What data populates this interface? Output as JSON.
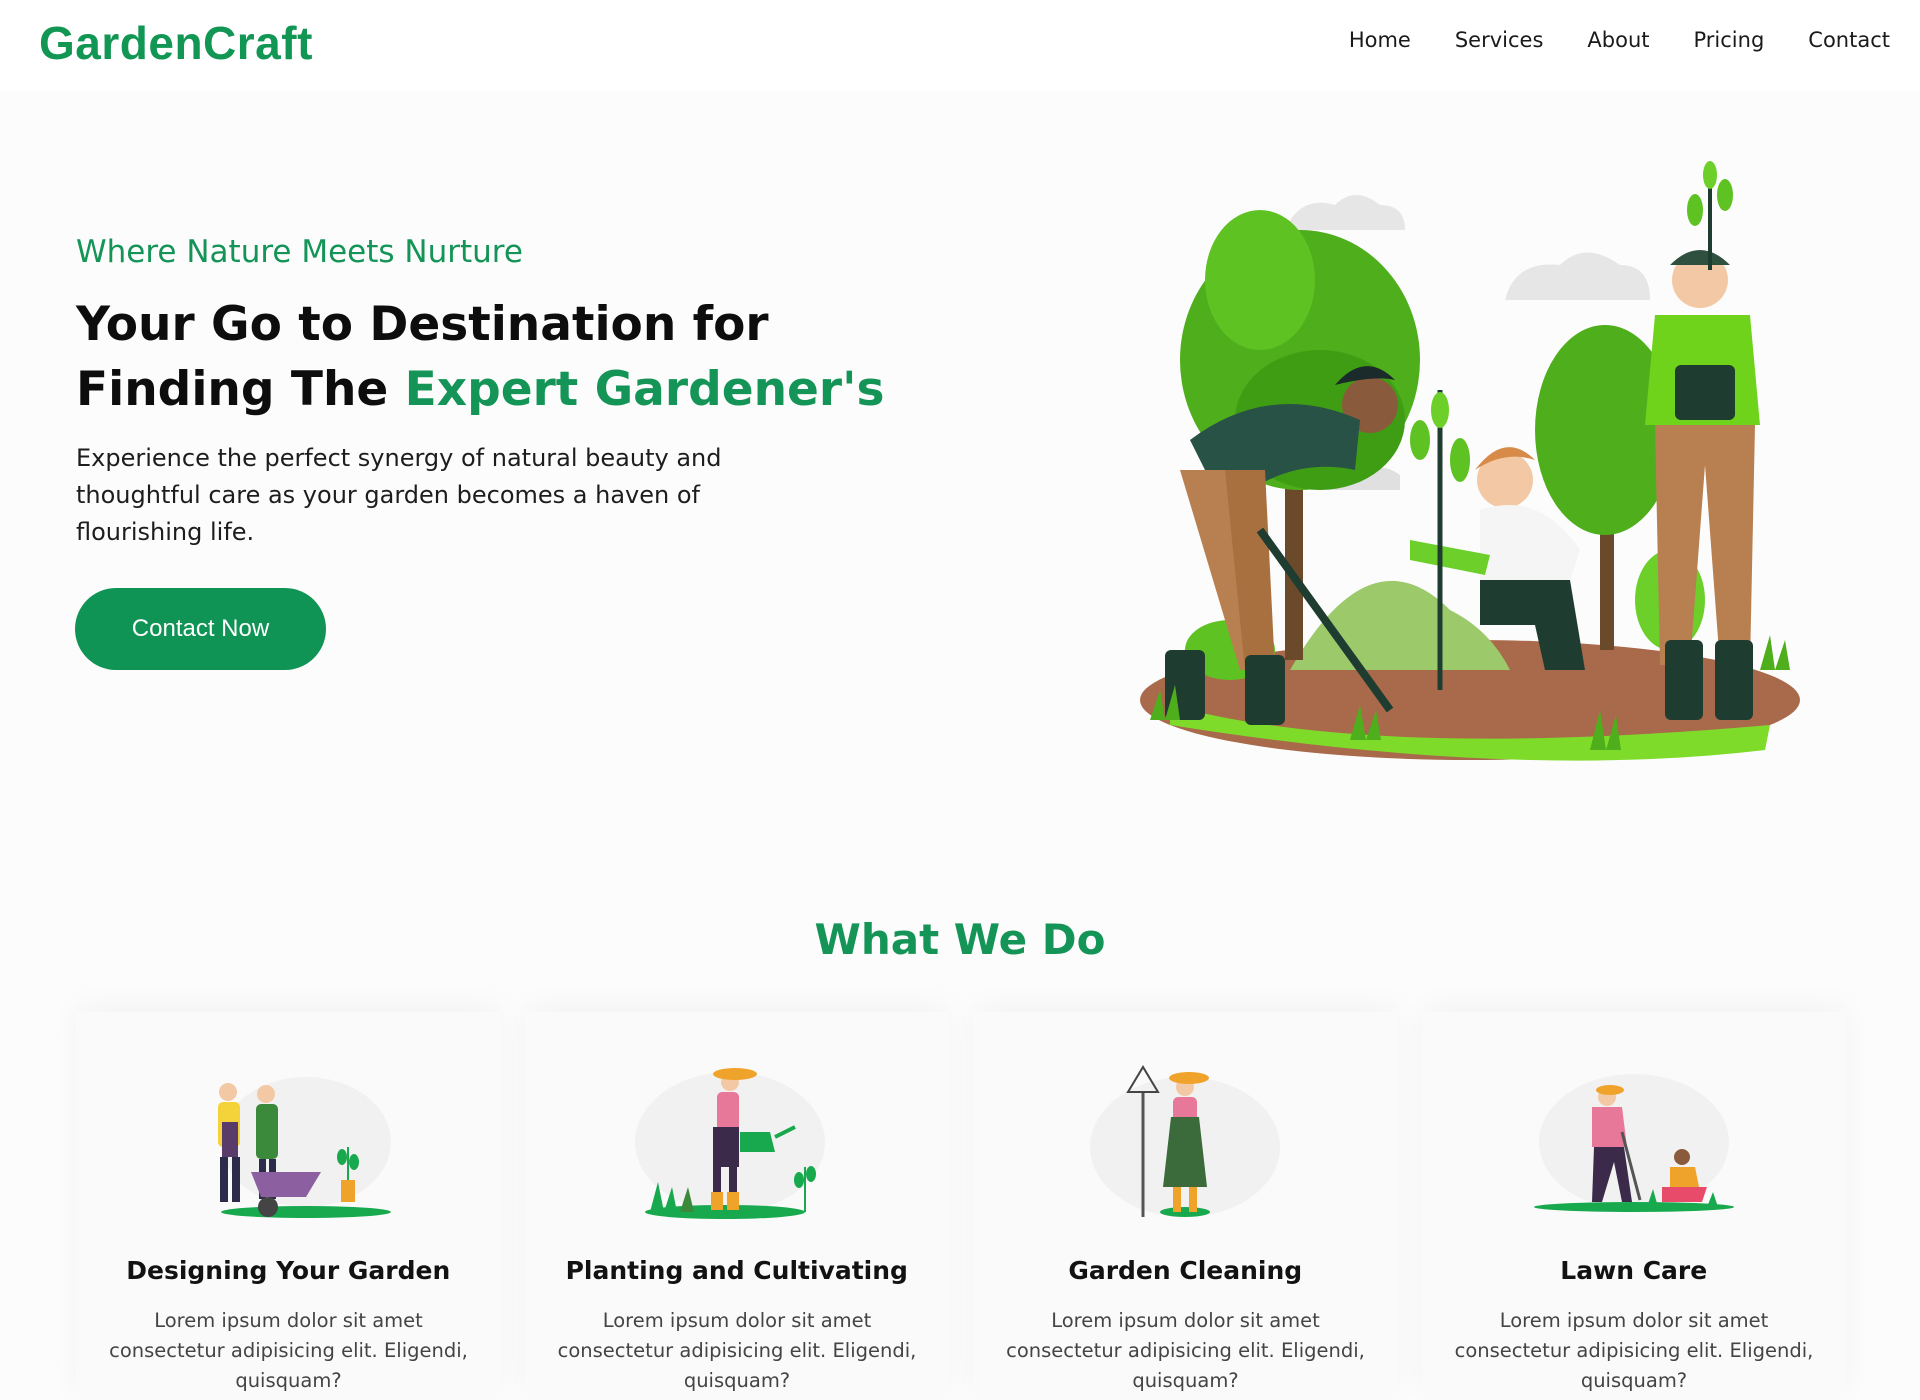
{
  "header": {
    "logo": "GardenCraft",
    "nav": [
      "Home",
      "Services",
      "About",
      "Pricing",
      "Contact"
    ]
  },
  "hero": {
    "tagline": "Where Nature Meets Nurture",
    "title_line1": "Your Go to Destination for",
    "title_line2_prefix": "Finding The ",
    "title_line2_accent": "Expert Gardener's",
    "description": "Experience the perfect synergy of natural beauty and thoughtful care as your garden becomes a haven of flourishing life.",
    "cta": "Contact Now"
  },
  "services": {
    "heading": "What We Do",
    "cards": [
      {
        "title": "Designing Your Garden",
        "text": "Lorem ipsum dolor sit amet consectetur adipisicing elit. Eligendi, quisquam?",
        "icon": "garden-design-illustration"
      },
      {
        "title": "Planting and Cultivating",
        "text": "Lorem ipsum dolor sit amet consectetur adipisicing elit. Eligendi, quisquam?",
        "icon": "watering-plant-illustration"
      },
      {
        "title": "Garden Cleaning",
        "text": "Lorem ipsum dolor sit amet consectetur adipisicing elit. Eligendi, quisquam?",
        "icon": "gardener-rake-illustration"
      },
      {
        "title": "Lawn Care",
        "text": "Lorem ipsum dolor sit amet consectetur adipisicing elit. Eligendi, quisquam?",
        "icon": "lawn-care-illustration"
      }
    ]
  },
  "colors": {
    "brand": "#119654",
    "cta_bg": "#0f9455",
    "background": "#fcfcfc"
  }
}
